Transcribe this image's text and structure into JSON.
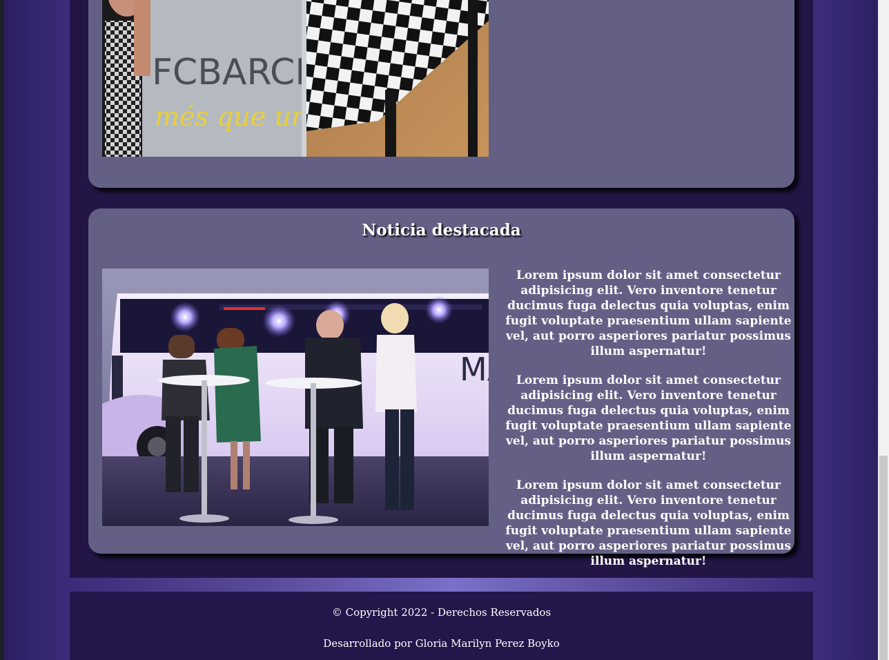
{
  "news": {
    "title": "Noticia destacada",
    "paragraphs": [
      "Lorem ipsum dolor sit amet consectetur adipisicing elit. Vero inventore tenetur ducimus fuga delectus quia voluptas, enim fugit voluptate praesentium ullam sapiente vel, aut porro asperiores pariatur possimus illum aspernatur!",
      "Lorem ipsum dolor sit amet consectetur adipisicing elit. Vero inventore tenetur ducimus fuga delectus quia voluptas, enim fugit voluptate praesentium ullam sapiente vel, aut porro asperiores pariatur possimus illum aspernatur!",
      "Lorem ipsum dolor sit amet consectetur adipisicing elit. Vero inventore tenetur ducimus fuga delectus quia voluptas, enim fugit voluptate praesentium ullam sapiente vel, aut porro asperiores pariatur possimus illum aspernatur!"
    ]
  },
  "top_photo": {
    "sign_text": "FCBARCE",
    "slogan_text": "més que un"
  },
  "bus_photo": {
    "bus_lettering": "MA"
  },
  "footer": {
    "copyright": "© Copyright 2022 - Derechos Reservados",
    "credit": "Desarrollado por Gloria Marilyn Perez Boyko"
  }
}
